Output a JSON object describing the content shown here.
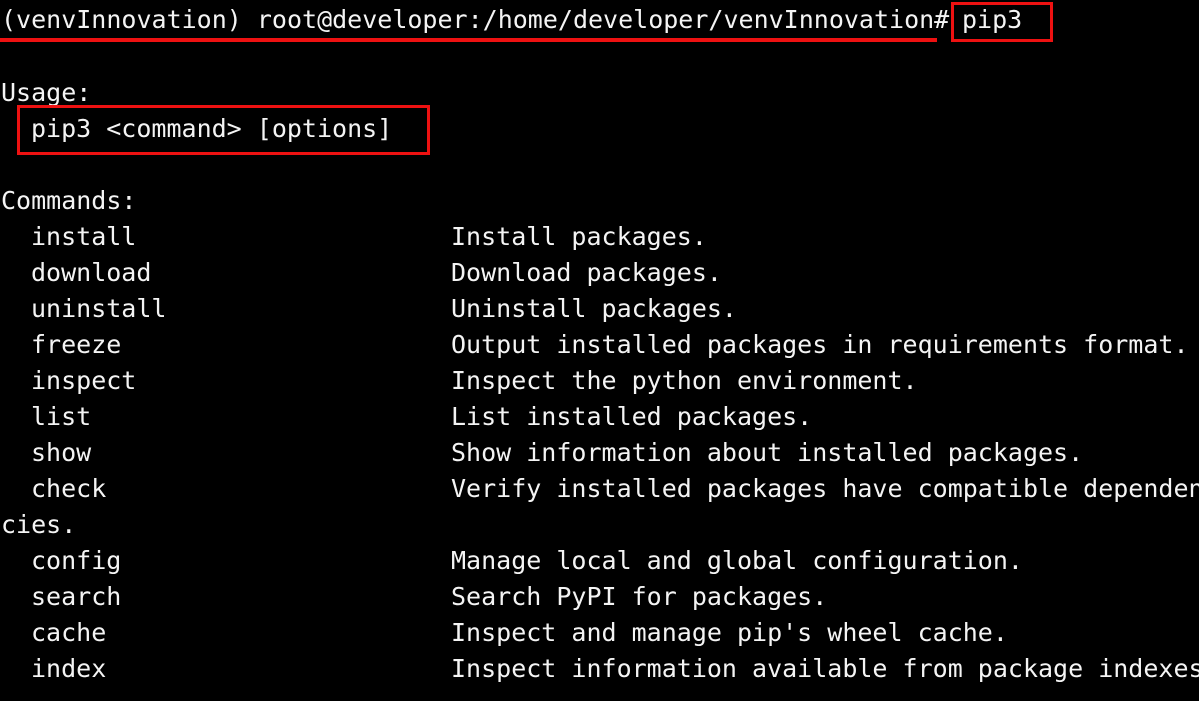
{
  "terminal": {
    "prompt": "(venvInnovation) root@developer:/home/developer/venvInnovation#",
    "typed_command": "pip3",
    "usage_heading": "Usage:",
    "usage_line": "pip3 <command> [options]",
    "commands_heading": "Commands:",
    "commands": [
      {
        "name": "install",
        "description": "Install packages."
      },
      {
        "name": "download",
        "description": "Download packages."
      },
      {
        "name": "uninstall",
        "description": "Uninstall packages."
      },
      {
        "name": "freeze",
        "description": "Output installed packages in requirements format."
      },
      {
        "name": "inspect",
        "description": "Inspect the python environment."
      },
      {
        "name": "list",
        "description": "List installed packages."
      },
      {
        "name": "show",
        "description": "Show information about installed packages."
      },
      {
        "name": "check",
        "description": "Verify installed packages have compatible dependen"
      },
      {
        "name": "config",
        "description": "Manage local and global configuration."
      },
      {
        "name": "search",
        "description": "Search PyPI for packages."
      },
      {
        "name": "cache",
        "description": "Inspect and manage pip's wheel cache."
      },
      {
        "name": "index",
        "description": "Inspect information available from package indexes"
      }
    ],
    "check_wrap": "cies.",
    "colors": {
      "background": "#000000",
      "text": "#f4f4f4",
      "annotation": "#ee1111"
    }
  }
}
